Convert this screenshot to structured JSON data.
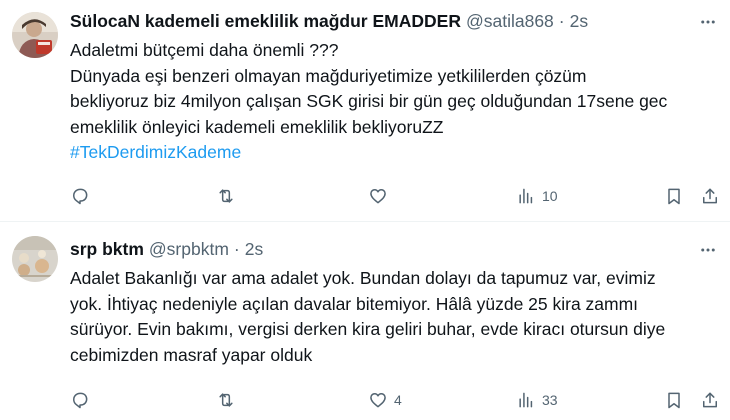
{
  "tweets": [
    {
      "author": {
        "name": "SülocaN kademeli emeklilik mağdur EMADDER",
        "handle": "@satila868",
        "time": "2s"
      },
      "lines": [
        "Adaletmi bütçemi daha önemli ???",
        "Dünyada eşi benzeri olmayan mağduriyetimize yetkililerden çözüm",
        "bekliyoruz biz 4milyon çalışan SGK girisi bir gün geç olduğundan 17sene gec",
        "emeklilik önleyici kademeli emeklilik bekliyoruZZ"
      ],
      "hashtag": "#TekDerdimizKademe",
      "stats": {
        "views": "10"
      }
    },
    {
      "author": {
        "name": "srp bktm",
        "handle": "@srpbktm",
        "time": "2s"
      },
      "lines": [
        "Adalet Bakanlığı var ama adalet yok. Bundan dolayı da tapumuz var, evimiz",
        "yok. İhtiyaç nedeniyle açılan davalar bitemiyor. Hâlâ yüzde 25 kira zammı",
        "sürüyor. Evin bakımı, vergisi derken kira geliri buhar, evde kiracı otursun diye",
        "cebimizden masraf yapar olduk"
      ],
      "stats": {
        "likes": "4",
        "views": "33"
      }
    }
  ],
  "separator": "·",
  "icons": {
    "reply": "reply-icon",
    "retweet": "retweet-icon",
    "like": "heart-icon",
    "views": "views-icon",
    "bookmark": "bookmark-icon",
    "share": "share-icon",
    "more": "more-icon"
  },
  "colors": {
    "text": "#0f1419",
    "secondary": "#536471",
    "link": "#1d9bf0",
    "divider": "#eff3f4"
  }
}
